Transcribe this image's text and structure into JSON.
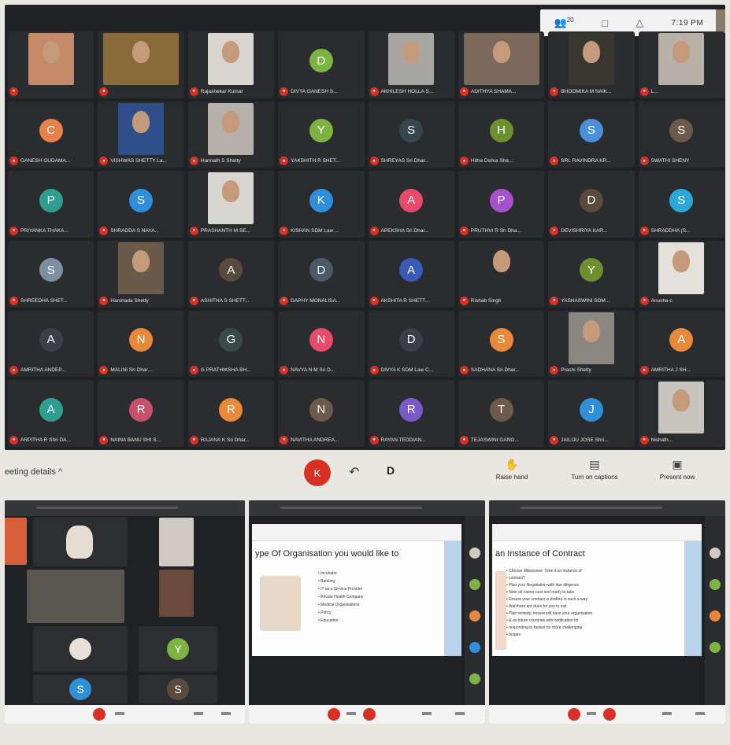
{
  "topbar": {
    "people_count": "20",
    "chat_icon": "chat-icon",
    "activities_icon": "activities-icon",
    "time": "7:19 PM"
  },
  "participants": [
    {
      "name": "",
      "initial": "",
      "type": "photo",
      "color": "#c48a6a"
    },
    {
      "name": "",
      "initial": "",
      "type": "photo-wide",
      "color": "#8b6a3a"
    },
    {
      "name": "Rajashekar Kumar",
      "initial": "",
      "type": "photo",
      "color": "#d9d5cf"
    },
    {
      "name": "DIVYA GANESH S...",
      "initial": "D",
      "type": "avatar",
      "color": "#7cb342"
    },
    {
      "name": "AKHILESH HOLLA S...",
      "initial": "",
      "type": "photo",
      "color": "#a8a6a2"
    },
    {
      "name": "ADITHYA SHAMA...",
      "initial": "",
      "type": "photo-wide",
      "color": "#7b6a5c"
    },
    {
      "name": "BHOOMIKA M NAIK...",
      "initial": "",
      "type": "photo",
      "color": "#3a3630"
    },
    {
      "name": "L...",
      "initial": "",
      "type": "photo",
      "color": "#b8b0a6"
    },
    {
      "name": "GANESH GUDAMA...",
      "initial": "C",
      "type": "avatar",
      "color": "#e8804a"
    },
    {
      "name": "VISHWAS SHETTY La...",
      "initial": "",
      "type": "photo",
      "color": "#2f4f8a"
    },
    {
      "name": "Harinath S Shetty",
      "initial": "",
      "type": "photo",
      "color": "#b5b1aa"
    },
    {
      "name": "YAKSHITH R SHET...",
      "initial": "Y",
      "type": "avatar",
      "color": "#7cb342"
    },
    {
      "name": "SHREYAS Sri Dhar...",
      "initial": "S",
      "type": "avatar",
      "color": "#37474f"
    },
    {
      "name": "Hitha Dsilva Sha...",
      "initial": "H",
      "type": "avatar",
      "color": "#6d8f2e"
    },
    {
      "name": "SRI. RAVINDRA KR...",
      "initial": "S",
      "type": "avatar",
      "color": "#4a90d9"
    },
    {
      "name": "SWATHI SHENY",
      "initial": "S",
      "type": "avatar",
      "color": "#6d5a4a"
    },
    {
      "name": "PRIYANKA THAKA...",
      "initial": "P",
      "type": "avatar",
      "color": "#2e9e8e"
    },
    {
      "name": "SHRADDA S NAYA...",
      "initial": "S",
      "type": "avatar",
      "color": "#2f8fd9"
    },
    {
      "name": "PRASHANTH M SE...",
      "initial": "",
      "type": "photo",
      "color": "#d8d6d0"
    },
    {
      "name": "KISHAN SDM Law ...",
      "initial": "K",
      "type": "avatar",
      "color": "#2f8fd9"
    },
    {
      "name": "APEKSHA Sri Dhar...",
      "initial": "A",
      "type": "avatar",
      "color": "#e84a6a"
    },
    {
      "name": "PRUTHVI R Sri Dha...",
      "initial": "P",
      "type": "avatar",
      "color": "#a452c9"
    },
    {
      "name": "DEVISHRIYA KAR...",
      "initial": "D",
      "type": "avatar",
      "color": "#5a4a3e"
    },
    {
      "name": "SHRADDHA (S...",
      "initial": "S",
      "type": "avatar",
      "color": "#2ba8d9"
    },
    {
      "name": "SHREEDHA SHET...",
      "initial": "S",
      "type": "avatar",
      "color": "#7f8fa0"
    },
    {
      "name": "Harshada Shetty",
      "initial": "",
      "type": "photo",
      "color": "#6a5a4a"
    },
    {
      "name": "ASHITHA S SHETT...",
      "initial": "A",
      "type": "avatar",
      "color": "#5a4a3e"
    },
    {
      "name": "DAPHY MONALISA...",
      "initial": "D",
      "type": "avatar",
      "color": "#4a5a6a"
    },
    {
      "name": "AKSHITA R SHETT...",
      "initial": "A",
      "type": "avatar",
      "color": "#3a5ab8"
    },
    {
      "name": "Rishab Singh",
      "initial": "",
      "type": "photo",
      "color": "#2a2c30"
    },
    {
      "name": "YASHASWINI SDM...",
      "initial": "Y",
      "type": "avatar",
      "color": "#6d8f2e"
    },
    {
      "name": "Anusha c",
      "initial": "",
      "type": "photo",
      "color": "#e4e0da"
    },
    {
      "name": "AMRITHA ANDEP...",
      "initial": "A",
      "type": "avatar",
      "color": "#3a4046"
    },
    {
      "name": "MALINI Sri Dhar...",
      "initial": "N",
      "type": "avatar",
      "color": "#e8883a"
    },
    {
      "name": "G PRATHIKSHA BH...",
      "initial": "G",
      "type": "avatar",
      "color": "#3a4a48"
    },
    {
      "name": "NAVYA N M Sri D...",
      "initial": "N",
      "type": "avatar",
      "color": "#e84a6a"
    },
    {
      "name": "DIVYA K SDM Law C...",
      "initial": "D",
      "type": "avatar",
      "color": "#3a4046"
    },
    {
      "name": "SADHANA Sri Dhar...",
      "initial": "S",
      "type": "avatar",
      "color": "#e8883a"
    },
    {
      "name": "Prashi Shetty",
      "initial": "",
      "type": "photo",
      "color": "#8a8680"
    },
    {
      "name": "AMRITHA J SH...",
      "initial": "A",
      "type": "avatar",
      "color": "#e8883a"
    },
    {
      "name": "ARPITHA R Shri DA...",
      "initial": "A",
      "type": "avatar",
      "color": "#2e9e8e"
    },
    {
      "name": "NAINA BANU SHI S...",
      "initial": "R",
      "type": "avatar",
      "color": "#c8506a"
    },
    {
      "name": "RAJANA K Sri Dhar...",
      "initial": "R",
      "type": "avatar",
      "color": "#e8883a"
    },
    {
      "name": "NAVITHA ANDREA...",
      "initial": "N",
      "type": "avatar",
      "color": "#6d5a4a"
    },
    {
      "name": "RAYAN TEDDIAN...",
      "initial": "R",
      "type": "avatar",
      "color": "#7a5ac9"
    },
    {
      "name": "TEJASWINI GANG...",
      "initial": "T",
      "type": "avatar",
      "color": "#6d5a4a"
    },
    {
      "name": "JAILIJU JOSE Shri...",
      "initial": "J",
      "type": "avatar",
      "color": "#2f8fd9"
    },
    {
      "name": "Nishath...",
      "initial": "",
      "type": "photo",
      "color": "#c8c4be"
    }
  ],
  "controls": {
    "meeting_details": "eeting details ^",
    "end_initial": "K",
    "raise_hand": "Raise hand",
    "captions": "Turn on captions",
    "present": "Present now"
  },
  "slide1": {
    "title": "ype Of Organisation you would like to",
    "items": [
      "Incubator",
      "Banking",
      "IT as a Service Provider",
      "Private Health Company",
      "Medical Organisations",
      "Policy",
      "Education"
    ]
  },
  "slide2": {
    "title": "an Instance of Contract",
    "items": [
      "Choose Milestones: Time it an instance of",
      "contract?",
      "Plan your Negotiation with due diligence",
      "Note all carrier cost and ready to take",
      "Ensure your contract is drafted in such a way",
      "that there are dues for you to exit",
      "Plan remedy, ensure will have your organisation",
      "& as future countries with notification for",
      "responding to fastest for more challenging",
      "bulges"
    ]
  },
  "panel1_initials": [
    "Y",
    "S",
    "S"
  ]
}
